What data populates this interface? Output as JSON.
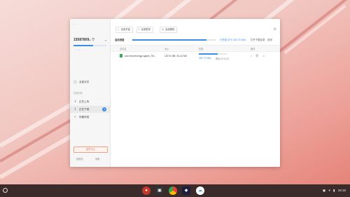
{
  "window": {
    "sidebar": {
      "top_hint": "· · ·",
      "username": "15587809₄ ♡",
      "quota_text": "···· ··/·· ····",
      "quota_fraction": 0.6,
      "nav": [
        {
          "label": "全部文件",
          "icon": "file-icon"
        },
        {
          "label": "正在上传",
          "icon": "upload-icon"
        },
        {
          "label": "正在下载",
          "icon": "download-icon",
          "badge": "1"
        },
        {
          "label": "传输完成",
          "icon": "check-icon"
        }
      ],
      "group_title": "传输列表",
      "vip_button": "会员中心",
      "footer_left": "回收站",
      "footer_right": "设置"
    },
    "toolbar": {
      "start_all": "全部开始",
      "pause_all": "全部暂停",
      "delete_all": "全部删除"
    },
    "totals": {
      "label": "当前进度",
      "progress_fraction": 0.88,
      "value": "已完成 87% 305.72 KB/s",
      "open_dir": "打开下载目录",
      "close": "关闭"
    },
    "table": {
      "col_name": "文件名",
      "col_size": "大小",
      "col_status": "状态",
      "col_action": "操作"
    },
    "row": {
      "filename": "com.tencent.tmgp.sgame_TM...",
      "size": "120.91 MB / 81.42 MB",
      "progress_fraction": 0.67,
      "speed": "305.72 KB/s",
      "remain": "剩余 00:12:21"
    }
  },
  "shelf": {
    "apps": [
      "app-record",
      "app-terminal",
      "app-chrome",
      "app-ide",
      "app-netdisk"
    ],
    "time": "16:16"
  }
}
